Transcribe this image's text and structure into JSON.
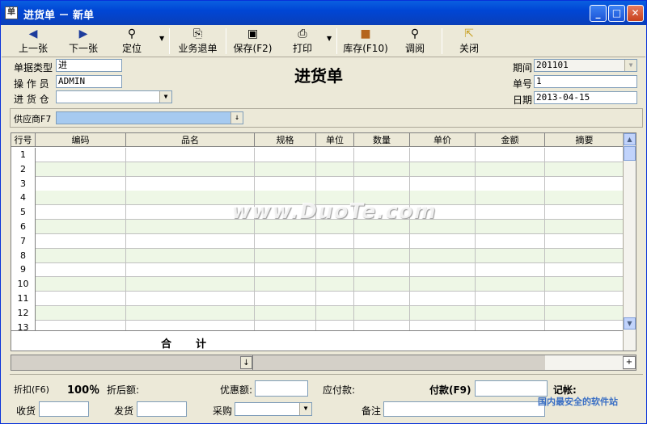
{
  "window": {
    "title": "进货单 － 新单",
    "app_icon": "document-icon"
  },
  "toolbar": {
    "prev": "上一张",
    "next": "下一张",
    "locate": "定位",
    "return": "业务退单",
    "save": "保存(F2)",
    "print": "打印",
    "stock": "库存(F10)",
    "view": "调阅",
    "close": "关闭"
  },
  "header": {
    "doc_type_label": "单据类型",
    "doc_type_value": "进",
    "operator_label": "操 作 员",
    "operator_value": "ADMIN",
    "warehouse_label": "进 货 仓",
    "warehouse_value": "",
    "form_title": "进货单",
    "period_label": "期间",
    "period_value": "201101",
    "number_label": "单号",
    "number_value": "1",
    "date_label": "日期",
    "date_value": "2013-04-15"
  },
  "supplier": {
    "label": "供应商F7",
    "value": ""
  },
  "grid": {
    "columns": [
      "行号",
      "编码",
      "品名",
      "规格",
      "单位",
      "数量",
      "单价",
      "金额",
      "摘要"
    ],
    "rows": [
      "1",
      "2",
      "3",
      "4",
      "5",
      "6",
      "7",
      "8",
      "9",
      "10",
      "11",
      "12",
      "13"
    ],
    "total_label": "合计"
  },
  "footer": {
    "discount_label": "折扣(F6)",
    "discount_value": "100％",
    "after_discount_label": "折后额:",
    "after_discount_value": "",
    "preferential_label": "优惠额:",
    "preferential_value": "",
    "payable_label": "应付款:",
    "payable_value": "",
    "paid_label": "付款(F9)",
    "paid_value": "",
    "posted_label": "记帐:",
    "receive_label": "收货",
    "ship_label": "发货",
    "purchase_label": "采购",
    "remark_label": "备注"
  },
  "watermarks": {
    "main": "www.DuoTe.com",
    "corner": "国内最安全的软件站"
  },
  "colors": {
    "title_bar": "#0A5FE0",
    "grid_alt": "#EEF7E6",
    "grid_head": "#ECE9D8"
  }
}
